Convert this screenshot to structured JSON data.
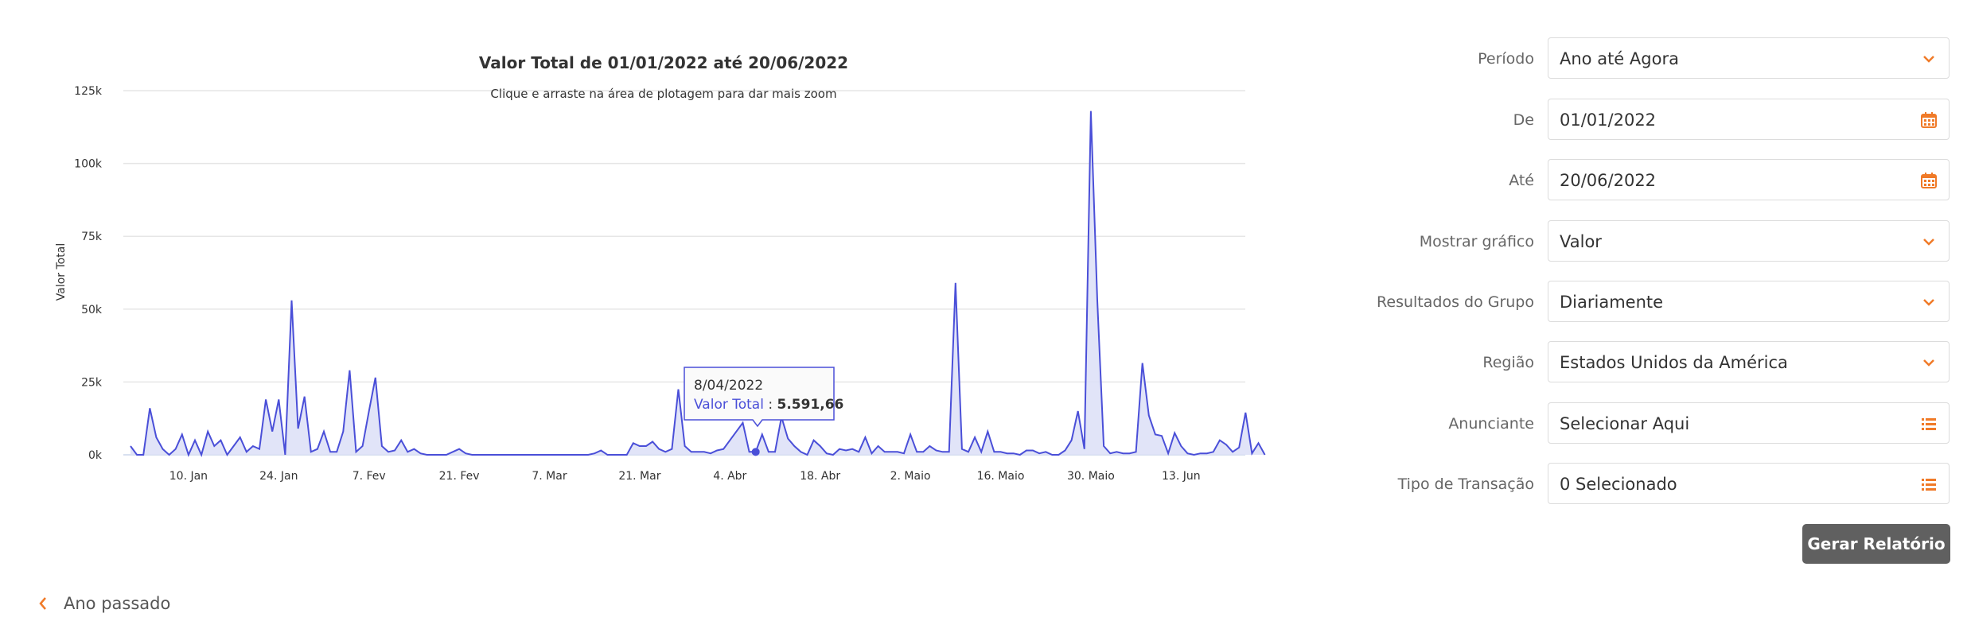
{
  "chart_data": {
    "type": "area",
    "title": "Valor Total de 01/01/2022 até 20/06/2022",
    "subtitle": "Clique e arraste na área de plotagem para dar mais zoom",
    "ylabel": "Valor Total",
    "ylim": [
      0,
      125000
    ],
    "yticks": [
      0,
      25000,
      50000,
      75000,
      100000,
      125000
    ],
    "ytick_labels": [
      "0k",
      "25k",
      "50k",
      "75k",
      "100k",
      "125k"
    ],
    "xticks": [
      {
        "day": 9,
        "label": "10. Jan"
      },
      {
        "day": 23,
        "label": "24. Jan"
      },
      {
        "day": 37,
        "label": "7. Fev"
      },
      {
        "day": 51,
        "label": "21. Fev"
      },
      {
        "day": 65,
        "label": "7. Mar"
      },
      {
        "day": 79,
        "label": "21. Mar"
      },
      {
        "day": 93,
        "label": "4. Abr"
      },
      {
        "day": 107,
        "label": "18. Abr"
      },
      {
        "day": 121,
        "label": "2. Maio"
      },
      {
        "day": 135,
        "label": "16. Maio"
      },
      {
        "day": 149,
        "label": "30. Maio"
      },
      {
        "day": 163,
        "label": "13. Jun"
      }
    ],
    "series": [
      {
        "name": "Valor Total",
        "color": "#4a4fd8",
        "fill": "#dcdff7",
        "values": [
          3000,
          0,
          0,
          16000,
          6000,
          2000,
          0,
          2000,
          7000,
          0,
          5000,
          0,
          8000,
          3000,
          5000,
          0,
          3000,
          6000,
          1000,
          3000,
          2000,
          19000,
          8000,
          19000,
          0,
          53000,
          9000,
          20000,
          1000,
          2000,
          8000,
          1000,
          1000,
          8000,
          29000,
          1000,
          3000,
          15000,
          26500,
          3000,
          1000,
          1500,
          5000,
          1000,
          2000,
          500,
          0,
          0,
          0,
          0,
          1000,
          2000,
          500,
          0,
          0,
          0,
          0,
          0,
          0,
          0,
          0,
          0,
          0,
          0,
          0,
          0,
          0,
          0,
          0,
          0,
          0,
          0,
          500,
          1500,
          0,
          0,
          0,
          0,
          4000,
          3000,
          3000,
          4500,
          2000,
          1000,
          2000,
          22500,
          3000,
          1000,
          1000,
          1000,
          500,
          1500,
          2000,
          5000,
          8000,
          11000,
          1000,
          1000,
          7000,
          1000,
          1000,
          13000,
          5591.66,
          3000,
          1000,
          0,
          5000,
          3000,
          500,
          0,
          2000,
          1500,
          2000,
          1000,
          6000,
          500,
          3000,
          1000,
          1000,
          1000,
          500,
          7000,
          1000,
          1000,
          3000,
          1500,
          1000,
          1000,
          59000,
          2000,
          1000,
          6000,
          1000,
          8000,
          1000,
          1000,
          500,
          500,
          0,
          1500,
          1500,
          500,
          1000,
          0,
          0,
          1500,
          5000,
          15000,
          2000,
          118000,
          53000,
          3000,
          500,
          1000,
          500,
          500,
          1000,
          31500,
          13500,
          7000,
          6500,
          500,
          7500,
          3000,
          500,
          0,
          500,
          500,
          1000,
          5000,
          3500,
          1000,
          2500,
          14500,
          500,
          4000,
          0
        ]
      }
    ],
    "tooltip": {
      "day": 97,
      "date": "8/04/2022",
      "series_label": "Valor Total",
      "value_text": "5.591,66"
    }
  },
  "form": {
    "periodo": {
      "label": "Período",
      "value": "Ano até Agora",
      "icon": "chevron-down-icon"
    },
    "de": {
      "label": "De",
      "value": "01/01/2022",
      "icon": "calendar-icon"
    },
    "ate": {
      "label": "Até",
      "value": "20/06/2022",
      "icon": "calendar-icon"
    },
    "mostrar_grafico": {
      "label": "Mostrar gráfico",
      "value": "Valor",
      "icon": "chevron-down-icon"
    },
    "resultados_grupo": {
      "label": "Resultados do Grupo",
      "value": "Diariamente",
      "icon": "chevron-down-icon"
    },
    "regiao": {
      "label": "Região",
      "value": "Estados Unidos da América",
      "icon": "chevron-down-icon"
    },
    "anunciante": {
      "label": "Anunciante",
      "value": "Selecionar Aqui",
      "icon": "list-icon"
    },
    "tipo_transacao": {
      "label": "Tipo de Transação",
      "value": "0 Selecionado",
      "icon": "list-icon"
    }
  },
  "buttons": {
    "gerar_relatorio": "Gerar Relatório"
  },
  "nav": {
    "previous_label": "Ano passado",
    "icon": "chevron-left-icon"
  },
  "colors": {
    "accent": "#f07a28",
    "series_line": "#4a4fd8",
    "series_fill": "#dcdff7",
    "button_bg": "#606060"
  }
}
